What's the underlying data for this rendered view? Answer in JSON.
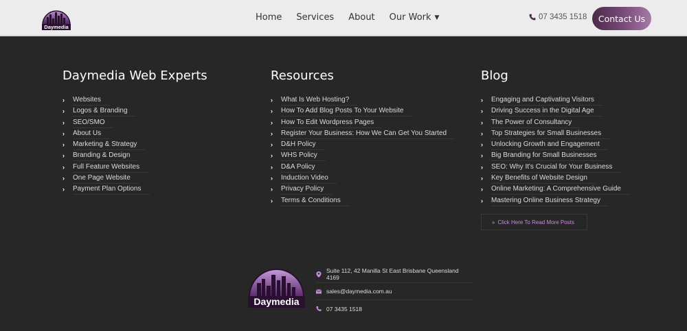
{
  "header": {
    "logo_text": "Daymedia",
    "nav": [
      {
        "label": "Home"
      },
      {
        "label": "Services"
      },
      {
        "label": "About"
      },
      {
        "label": "Our Work",
        "dropdown": true
      }
    ],
    "phone": "07 3435 1518",
    "cta": "Contact Us"
  },
  "colors": {
    "footer_bg": "#272727",
    "header_bg": "#ececec",
    "accent_purple": "#7a4d7a",
    "link_purple": "#c58fd6"
  },
  "columns": {
    "experts": {
      "title": "Daymedia Web Experts",
      "items": [
        "Websites",
        "Logos & Branding",
        "SEO/SMO",
        "About Us",
        "Marketing & Strategy",
        "Branding & Design",
        "Full Feature Websites",
        "One Page Website",
        "Payment Plan Options"
      ]
    },
    "resources": {
      "title": "Resources",
      "items": [
        "What Is Web Hosting?",
        "How To Add Blog Posts To Your Website",
        "How To Edit Wordpress Pages",
        "Register Your Business: How We Can Get You Started",
        "D&H Policy",
        "WHS Policy",
        "D&A Policy",
        "Induction Video",
        "Privacy Policy",
        "Terms & Conditions"
      ]
    },
    "blog": {
      "title": "Blog",
      "items": [
        "Engaging and Captivating Visitors",
        "Driving Success in the Digital Age",
        "The Power of Consultancy",
        "Top Strategies for Small Businesses",
        "Unlocking Growth and Engagement",
        "Big Branding for Small Businesses",
        "SEO: Why It's Crucial for Your Business",
        "Key Benefits of Website Design",
        "Online Marketing: A Comprehensive Guide",
        "Mastering Online Business Strategy"
      ],
      "read_more": "Click Here To Read More Posts"
    }
  },
  "footer": {
    "address": "Suite 112, 42 Manilla St East Brisbane Queensland 4169",
    "email": "sales@daymedia.com.au",
    "phone": "07 3435 1518"
  }
}
